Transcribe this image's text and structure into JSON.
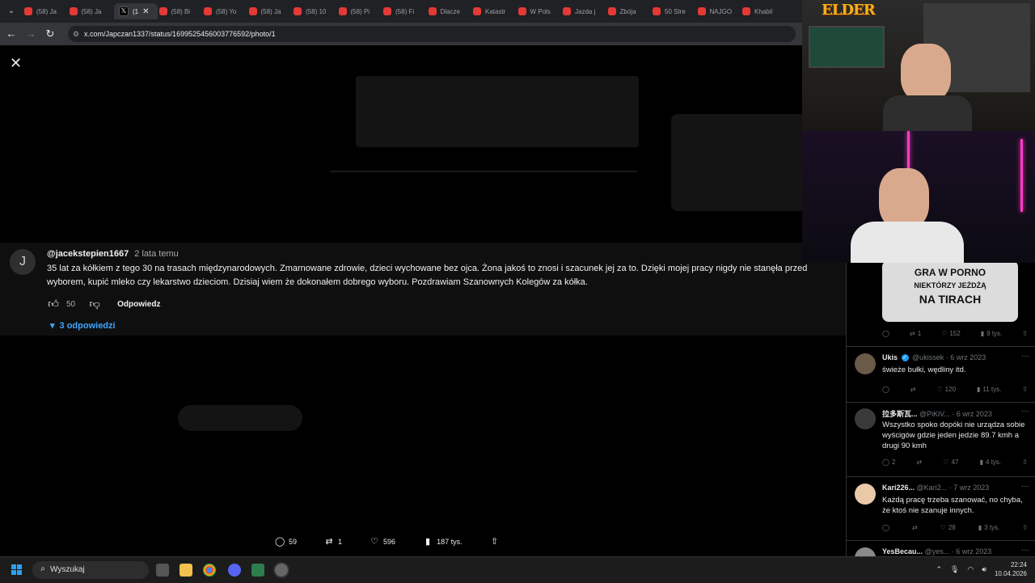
{
  "browser": {
    "tabs": [
      {
        "label": "(58) Ja"
      },
      {
        "label": "(58) Ja"
      },
      {
        "label": "(1"
      },
      {
        "label": "(58) Bi"
      },
      {
        "label": "(58) Yo"
      },
      {
        "label": "(58) Ja"
      },
      {
        "label": "(58) 10"
      },
      {
        "label": "(58) Pi"
      },
      {
        "label": "(58) Fi"
      },
      {
        "label": "Dlacze"
      },
      {
        "label": "Katastr"
      },
      {
        "label": "W Pols"
      },
      {
        "label": "Jazda j"
      },
      {
        "label": "Zbója"
      },
      {
        "label": "50 Stre"
      },
      {
        "label": "NAJGO"
      },
      {
        "label": "Khabil"
      }
    ],
    "url": "x.com/Japczan1337/status/1699525456003776592/photo/1"
  },
  "comment": {
    "avatar_letter": "J",
    "author": "@jacekstepien1667",
    "time": "2 lata temu",
    "text": "35 lat za kółkiem z tego 30 na trasach międzynarodowych. Zmarnowane zdrowie, dzieci wychowane bez ojca. Żona jakoś to znosi i szacunek jej za to. Dzięki mojej pracy nigdy nie stanęła przed wyborem, kupić mleko czy lekarstwo dzieciom. Dzisiaj wiem że dokonałem dobrego wyboru. Pozdrawiam Szanownych Kolegów za kółka.",
    "likes": "50",
    "reply_label": "Odpowiedz",
    "replies_label": "3 odpowiedzi"
  },
  "tweet_actions": {
    "replies": "59",
    "retweets": "1",
    "likes": "596",
    "views": "187 tys."
  },
  "sidebar": {
    "image_text": [
      "GRA W PORNO",
      "NIEKTÓRZY JEŻDŻĄ",
      "NA TIRACH"
    ],
    "top_actions": {
      "retweets": "1",
      "likes": "152",
      "views": "9 tys."
    },
    "replies": [
      {
        "name": "Ukis",
        "handle": "@ukissek",
        "date": "6 wrz 2023",
        "text": "świeże bułki, wędliny itd.",
        "verified": true,
        "retweets": "",
        "likes": "120",
        "views": "11 tys."
      },
      {
        "name": "拉多斯瓦...",
        "handle": "@PiKiV...",
        "date": "6 wrz 2023",
        "text": "Wszystko spoko dopóki nie urządza sobie wyścigów gdzie jeden jedzie 89.7 kmh a drugi 90 kmh",
        "verified": false,
        "replies": "2",
        "likes": "47",
        "views": "4 tys."
      },
      {
        "name": "Kari226...",
        "handle": "@Kari2...",
        "date": "7 wrz 2023",
        "text": "Każdą pracę trzeba szanować, no chyba, że ktoś nie szanuje innych.",
        "verified": false,
        "likes": "28",
        "views": "3 tys."
      },
      {
        "name": "YesBecau...",
        "handle": "@yes...",
        "date": "6 wrz 2023"
      }
    ]
  },
  "webcam": {
    "logo": "ELDER"
  },
  "taskbar": {
    "search_placeholder": "Wyszukaj",
    "time": "22:24",
    "date": "10.04.2026"
  },
  "colors": {
    "link_blue": "#3ea6ff",
    "verified_blue": "#1d9bf0",
    "youtube_red": "#e53935"
  }
}
